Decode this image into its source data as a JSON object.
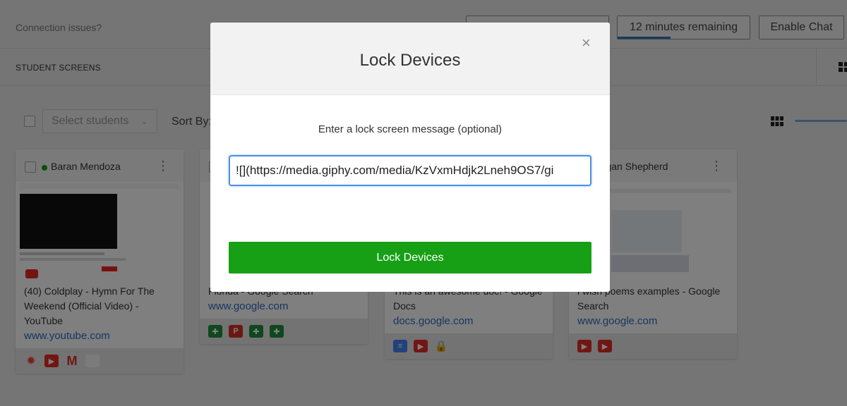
{
  "topbar": {
    "connection_link": "Connection issues?",
    "time_remaining": "12 minutes remaining",
    "enable_chat": "Enable Chat"
  },
  "section": {
    "title": "STUDENT SCREENS"
  },
  "controls": {
    "select_students_placeholder": "Select students",
    "sort_by_label": "Sort By:"
  },
  "cards": [
    {
      "student": "Baran Mendoza",
      "page_title": "(40) Coldplay - Hymn For The Weekend (Official Video) - YouTube",
      "url": "www.youtube.com",
      "tab_icons": [
        "app-icon",
        "youtube-icon",
        "gmail-icon",
        "blank-tab-icon"
      ]
    },
    {
      "student": "",
      "page_title": "Florida - Google Search",
      "url": "www.google.com",
      "tab_icons": [
        "green-t-icon",
        "red-p-icon",
        "green-t-icon",
        "green-t-icon"
      ]
    },
    {
      "student": "",
      "page_title": "This is an awesome doc! - Google Docs",
      "url": "docs.google.com",
      "tab_icons": [
        "google-docs-icon",
        "youtube-icon",
        "lock-icon"
      ]
    },
    {
      "student": "Morgan Shepherd",
      "student_visible": "organ Shepherd",
      "page_title": "i wish poems examples - Google Search",
      "url": "www.google.com",
      "tab_icons": [
        "youtube-icon",
        "youtube-icon"
      ]
    }
  ],
  "modal": {
    "title": "Lock Devices",
    "close_glyph": "×",
    "label": "Enter a lock screen message (optional)",
    "message_value": "![](https://media.giphy.com/media/KzVxmHdjk2Lneh9OS7/gi",
    "submit_label": "Lock Devices"
  },
  "colors": {
    "accent_green": "#17a015",
    "link_blue": "#2a6cc0",
    "focus_blue": "#4a90e2",
    "online_dot": "#1a9c1a"
  }
}
